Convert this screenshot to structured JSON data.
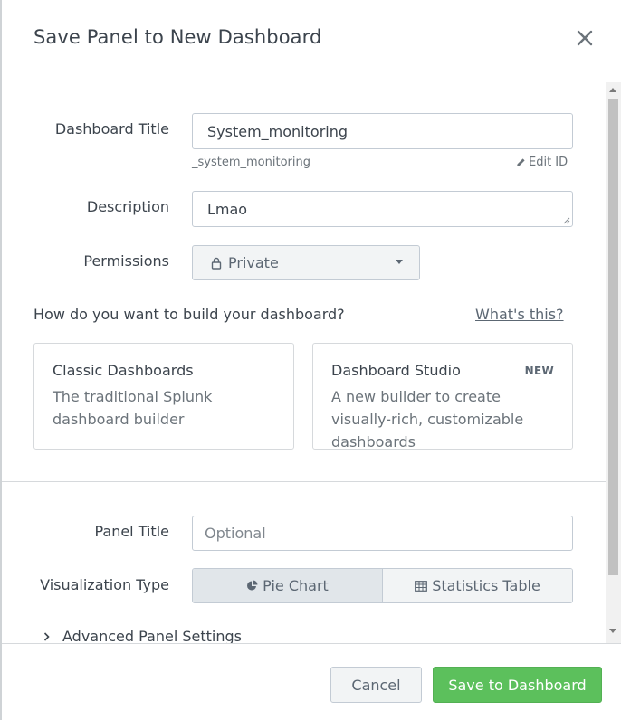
{
  "header": {
    "title": "Save Panel to New Dashboard",
    "close": "✕"
  },
  "form": {
    "dashboard_title_label": "Dashboard Title",
    "dashboard_title_value": "System_monitoring",
    "dashboard_id": "_system_monitoring",
    "edit_id": "Edit ID",
    "description_label": "Description",
    "description_value": "Lmao",
    "permissions_label": "Permissions",
    "permissions_value": "Private"
  },
  "build": {
    "question": "How do you want to build your dashboard?",
    "whats_this": "What's this?",
    "options": [
      {
        "title": "Classic Dashboards",
        "badge": "",
        "description": "The traditional Splunk dashboard builder"
      },
      {
        "title": "Dashboard Studio",
        "badge": "NEW",
        "description": "A new builder to create visually-rich, customizable dashboards"
      }
    ]
  },
  "panel": {
    "panel_title_label": "Panel Title",
    "panel_title_placeholder": "Optional",
    "viz_label": "Visualization Type",
    "viz_options": [
      "Pie Chart",
      "Statistics Table"
    ],
    "selected_viz": "Pie Chart",
    "advanced": "Advanced Panel Settings"
  },
  "footer": {
    "cancel": "Cancel",
    "save": "Save to Dashboard"
  },
  "colors": {
    "primary": "#5cc05c",
    "text": "#3c444d",
    "muted": "#6b737a",
    "border": "#c3cbd4"
  },
  "icons": [
    "close-icon",
    "pencil-icon",
    "lock-icon",
    "caret-down-icon",
    "pie-chart-icon",
    "table-icon",
    "chevron-right-icon"
  ]
}
